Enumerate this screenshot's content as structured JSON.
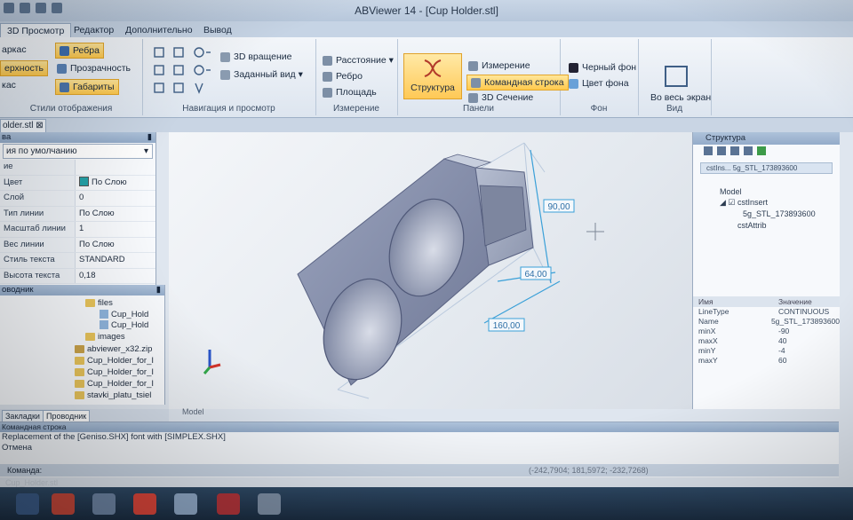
{
  "window": {
    "title": "ABViewer 14 - [Cup Holder.stl]"
  },
  "ribbon_tabs": [
    "3D Просмотр",
    "Редактор",
    "Дополнительно",
    "Вывод"
  ],
  "groups": {
    "display_styles": {
      "label": "Стили отображения",
      "items": [
        "аркас",
        "ерхность",
        "кас",
        "Ребра",
        "Прозрачность",
        "Габариты"
      ]
    },
    "navigation": {
      "label": "Навигация и просмотр",
      "items": [
        "3D вращение",
        "Заданный вид"
      ]
    },
    "measure": {
      "label": "Измерение",
      "items": [
        "Расстояние",
        "Ребро",
        "Площадь"
      ]
    },
    "panels": {
      "label": "Панели",
      "big": "Структура",
      "items": [
        "Измерение",
        "Командная строка",
        "3D Сечение"
      ]
    },
    "background": {
      "label": "Фон",
      "items": [
        "Черный фон",
        "Цвет фона"
      ]
    },
    "view": {
      "label": "Вид",
      "big": "Во весь экран"
    }
  },
  "doc_tab": "older.stl",
  "props_panel": {
    "title": "ва",
    "combo": "ия по умолчанию",
    "section": "ие",
    "rows": [
      {
        "k": "Цвет",
        "v": "По Слою"
      },
      {
        "k": "Слой",
        "v": "0"
      },
      {
        "k": "Тип линии",
        "v": "По Слою"
      },
      {
        "k": "Масштаб линии",
        "v": "1"
      },
      {
        "k": "Вес линии",
        "v": "По Слою"
      },
      {
        "k": "Стиль текста",
        "v": "STANDARD"
      },
      {
        "k": "Высота текста",
        "v": "0,18"
      }
    ]
  },
  "explorer": {
    "title": "оводник",
    "items": [
      "files",
      "Cup_Hold",
      "Cup_Hold",
      "images",
      "abviewer_x32.zip",
      "Cup_Holder_for_I",
      "Cup_Holder_for_I",
      "Cup_Holder_for_I",
      "stavki_platu_tsiel"
    ],
    "tabs": [
      "Закладки",
      "Проводник"
    ]
  },
  "viewport": {
    "label": "Model",
    "dims": [
      "90,00",
      "64,00",
      "160,00"
    ]
  },
  "structure_panel": {
    "title": "Структура",
    "selector": "cstIns...     5g_STL_173893600",
    "tree": [
      "Model",
      "cstInsert",
      "5g_STL_173893600",
      "cstAttrib"
    ],
    "table_head": [
      "Имя",
      "Значение"
    ],
    "table": [
      [
        "LineType",
        "CONTINUOUS"
      ],
      [
        "Name",
        "5g_STL_173893600"
      ],
      [
        "minX",
        "-90"
      ],
      [
        "maxX",
        "40"
      ],
      [
        "minY",
        "-4"
      ],
      [
        "maxY",
        "60"
      ]
    ]
  },
  "command": {
    "title": "Командная строка",
    "lines": [
      "Replacement of the [Geniso.SHX] font with [SIMPLEX.SHX]",
      "Отмена"
    ],
    "prompt": "Команда:",
    "coords": "(-242,7904; 181,5972; -232,7268)",
    "doc": "Cup_Holder.stl"
  }
}
